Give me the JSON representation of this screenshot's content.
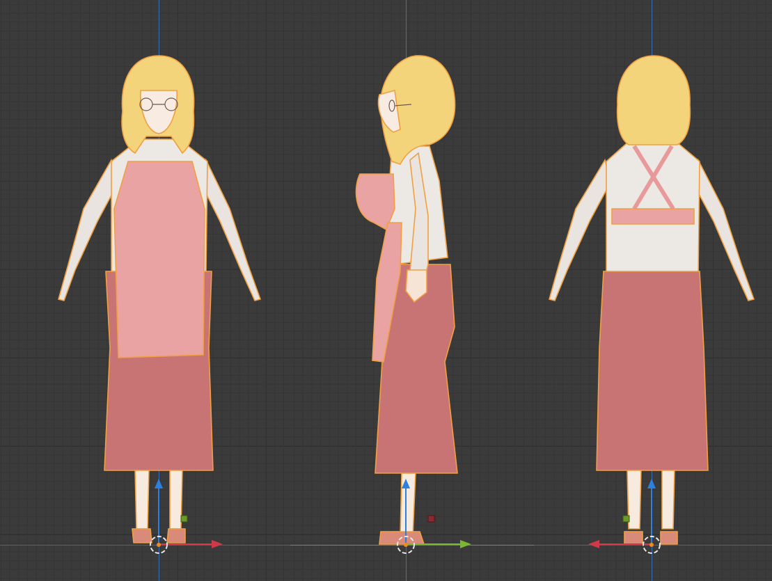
{
  "viewports": [
    {
      "view": "front"
    },
    {
      "view": "side"
    },
    {
      "view": "back"
    }
  ],
  "colors": {
    "background": "#3b3b3b",
    "grid_minor": "#353535",
    "grid_major": "#2b2b2b",
    "axis_x": "#d03a48",
    "axis_y": "#7ab830",
    "axis_z": "#2d7fe0",
    "selection_outline": "#f0a040",
    "hair": "#f3d47a",
    "sweater": "#ece8e4",
    "apron": "#eaa0a0",
    "skirt": "#c97474",
    "skin": "#f6e4d6",
    "sandal": "#c77a60"
  },
  "icons": {
    "origin": "3d-cursor-icon",
    "z_gizmo": "z-axis-arrow-icon",
    "x_gizmo": "x-axis-arrow-icon",
    "y_gizmo": "y-axis-arrow-icon"
  }
}
